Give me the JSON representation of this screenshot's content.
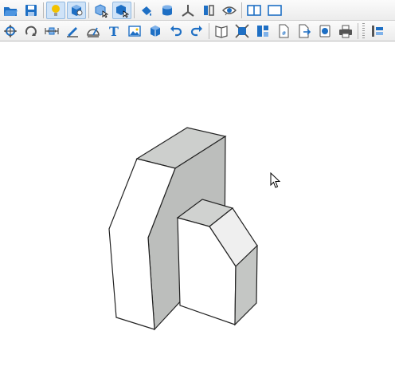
{
  "colors": {
    "accent": "#1e6fc4",
    "face_light": "#ffffff",
    "face_mid": "#bdbfbd",
    "face_dark": "#c8cac8",
    "toolbar_active": "#cfe3f8"
  },
  "toolbar_top": {
    "buttons": [
      {
        "icon": "open-folder-icon"
      },
      {
        "icon": "save-icon"
      },
      {
        "icon": "lightbulb-icon",
        "active": true
      },
      {
        "icon": "materials-icon",
        "active": true
      },
      {
        "icon": "select-box-icon"
      },
      {
        "icon": "select-cursor-icon",
        "active": true
      },
      {
        "icon": "paint-bucket-icon"
      },
      {
        "icon": "cylinder-icon"
      },
      {
        "icon": "axes-icon"
      },
      {
        "icon": "section-plane-icon"
      },
      {
        "icon": "eye-icon"
      },
      {
        "icon": "split-view-icon"
      },
      {
        "icon": "single-view-icon"
      }
    ]
  },
  "toolbar_bottom": {
    "buttons": [
      {
        "icon": "orbit-icon"
      },
      {
        "icon": "rotate-icon"
      },
      {
        "icon": "dimension-icon"
      },
      {
        "icon": "measure-icon"
      },
      {
        "icon": "protractor-icon"
      },
      {
        "icon": "text-icon",
        "glyph": "T"
      },
      {
        "icon": "image-icon"
      },
      {
        "icon": "cube-icon"
      },
      {
        "icon": "undo-icon"
      },
      {
        "icon": "redo-icon"
      },
      {
        "icon": "book-icon"
      },
      {
        "icon": "zoom-extents-icon"
      },
      {
        "icon": "layout-icon"
      },
      {
        "icon": "page-number-icon",
        "glyph": "#"
      },
      {
        "icon": "export-page-icon"
      },
      {
        "icon": "record-icon"
      },
      {
        "icon": "print-icon"
      },
      {
        "icon": "panel-toggle-icon"
      }
    ]
  }
}
